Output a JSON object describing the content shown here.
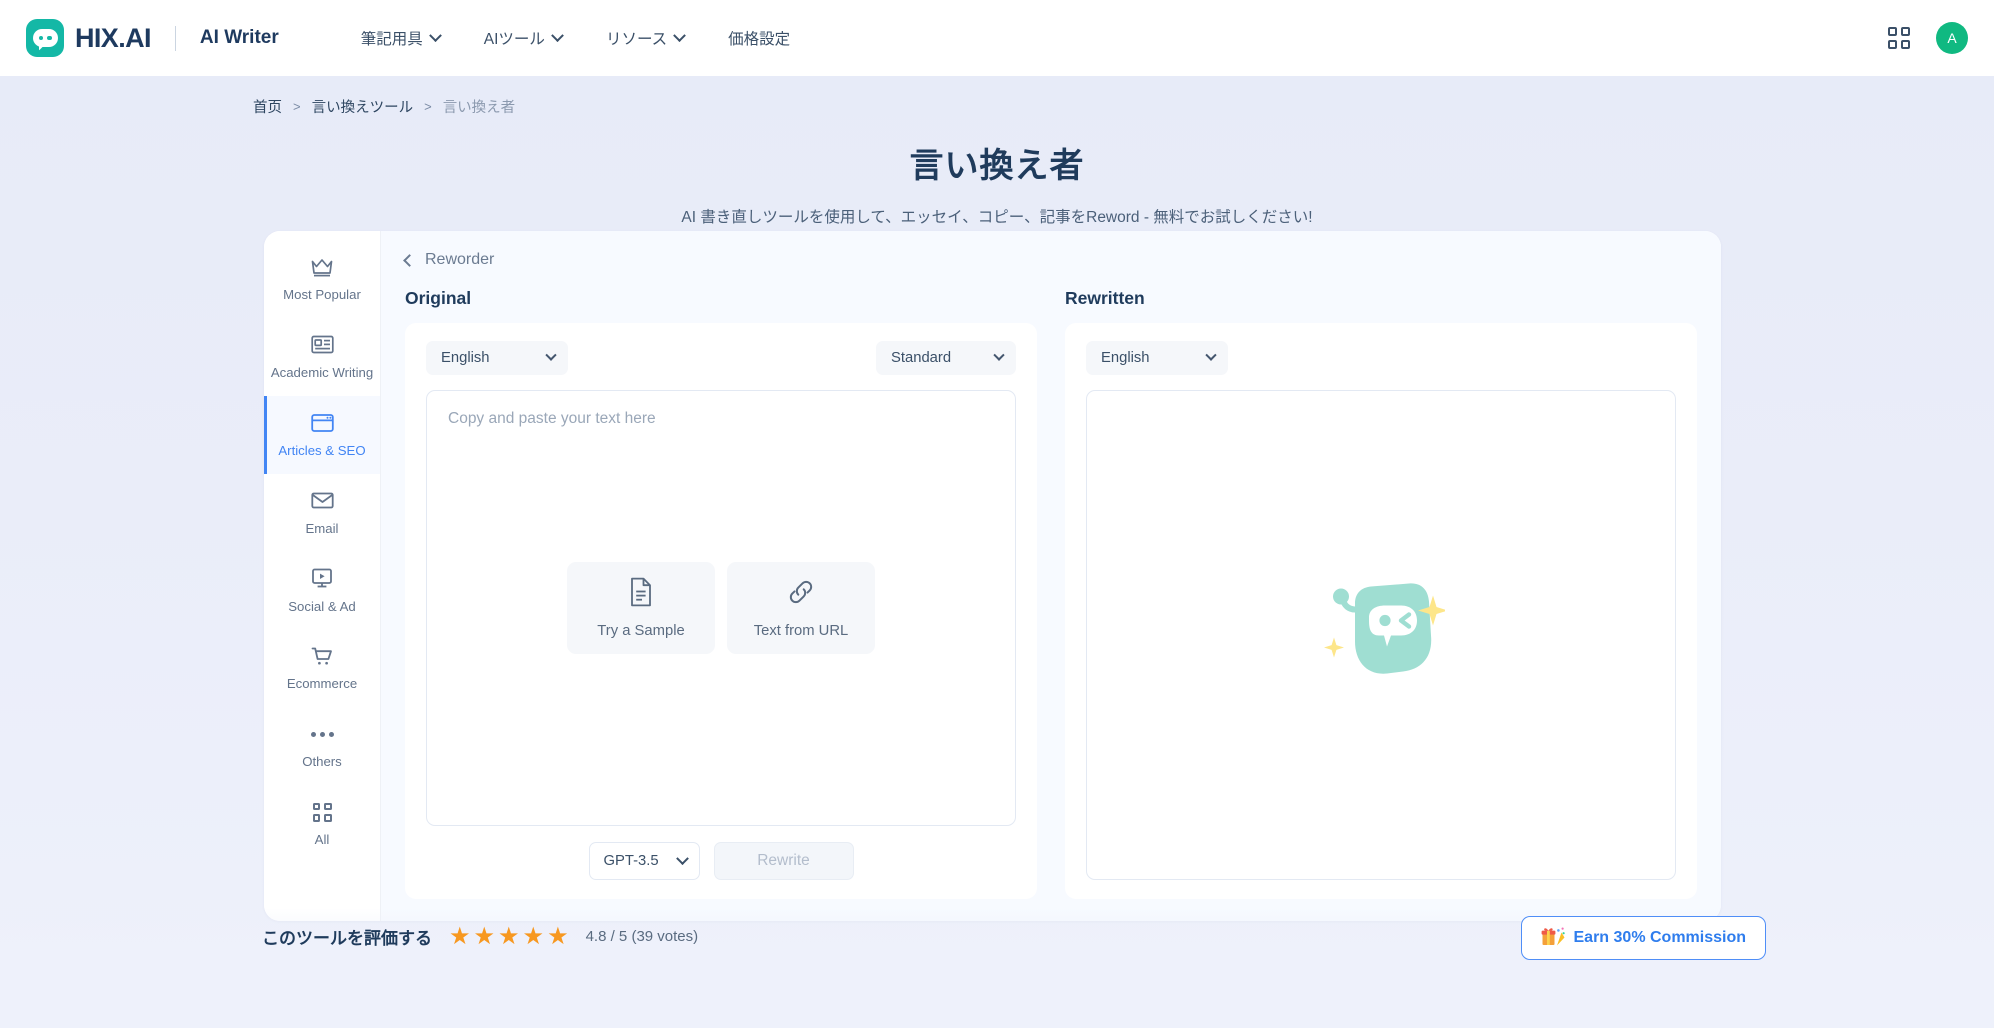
{
  "header": {
    "brand_name": "HIX.AI",
    "brand_sub": "AI Writer",
    "nav_items": [
      {
        "label": "筆記用具",
        "has_dropdown": true
      },
      {
        "label": "AIツール",
        "has_dropdown": true
      },
      {
        "label": "リソース",
        "has_dropdown": true
      },
      {
        "label": "価格設定",
        "has_dropdown": false
      }
    ],
    "apps_icon": "grid-icon",
    "avatar_initial": "A"
  },
  "breadcrumb": {
    "home": "首页",
    "sep": ">",
    "parent": "言い換えツール",
    "current": "言い換え者"
  },
  "hero": {
    "title": "言い換え者",
    "subtitle": "AI 書き直しツールを使用して、エッセイ、コピー、記事をReword - 無料でお試しください!"
  },
  "sidebar": {
    "items": [
      {
        "label": "Most Popular",
        "icon": "crown-icon",
        "active": false
      },
      {
        "label": "Academic Writing",
        "icon": "article-card-icon",
        "active": false
      },
      {
        "label": "Articles & SEO",
        "icon": "browser-window-icon",
        "active": true
      },
      {
        "label": "Email",
        "icon": "envelope-icon",
        "active": false
      },
      {
        "label": "Social & Ad",
        "icon": "monitor-play-icon",
        "active": false
      },
      {
        "label": "Ecommerce",
        "icon": "shopping-cart-icon",
        "active": false
      },
      {
        "label": "Others",
        "icon": "ellipsis-icon",
        "active": false
      },
      {
        "label": "All",
        "icon": "grid-icon",
        "active": false
      }
    ]
  },
  "tool": {
    "back_label": "Reworder",
    "original": {
      "heading": "Original",
      "language": "English",
      "tone": "Standard",
      "placeholder": "Copy and paste your text here",
      "quick_actions": [
        {
          "label": "Try a Sample",
          "icon": "document-icon"
        },
        {
          "label": "Text from URL",
          "icon": "link-icon"
        }
      ]
    },
    "rewritten": {
      "heading": "Rewritten",
      "language": "English",
      "mascot": "hix-chat-mascot-icon"
    },
    "model": "GPT-3.5",
    "rewrite_label": "Rewrite",
    "rewrite_disabled": true
  },
  "footer": {
    "rate_label": "このツールを評価する",
    "stars_filled": 5,
    "score_text": "4.8 / 5 (39 votes)",
    "commission_label": "Earn 30% Commission",
    "commission_icon": "gift-party-icon"
  },
  "colors": {
    "brand_teal": "#14b8a6",
    "accent_blue": "#4285f4",
    "star_orange": "#f79820",
    "mascot_mint": "#9fded2",
    "sparkle_yellow": "#fde68a",
    "title_navy": "#1f3b5c"
  }
}
